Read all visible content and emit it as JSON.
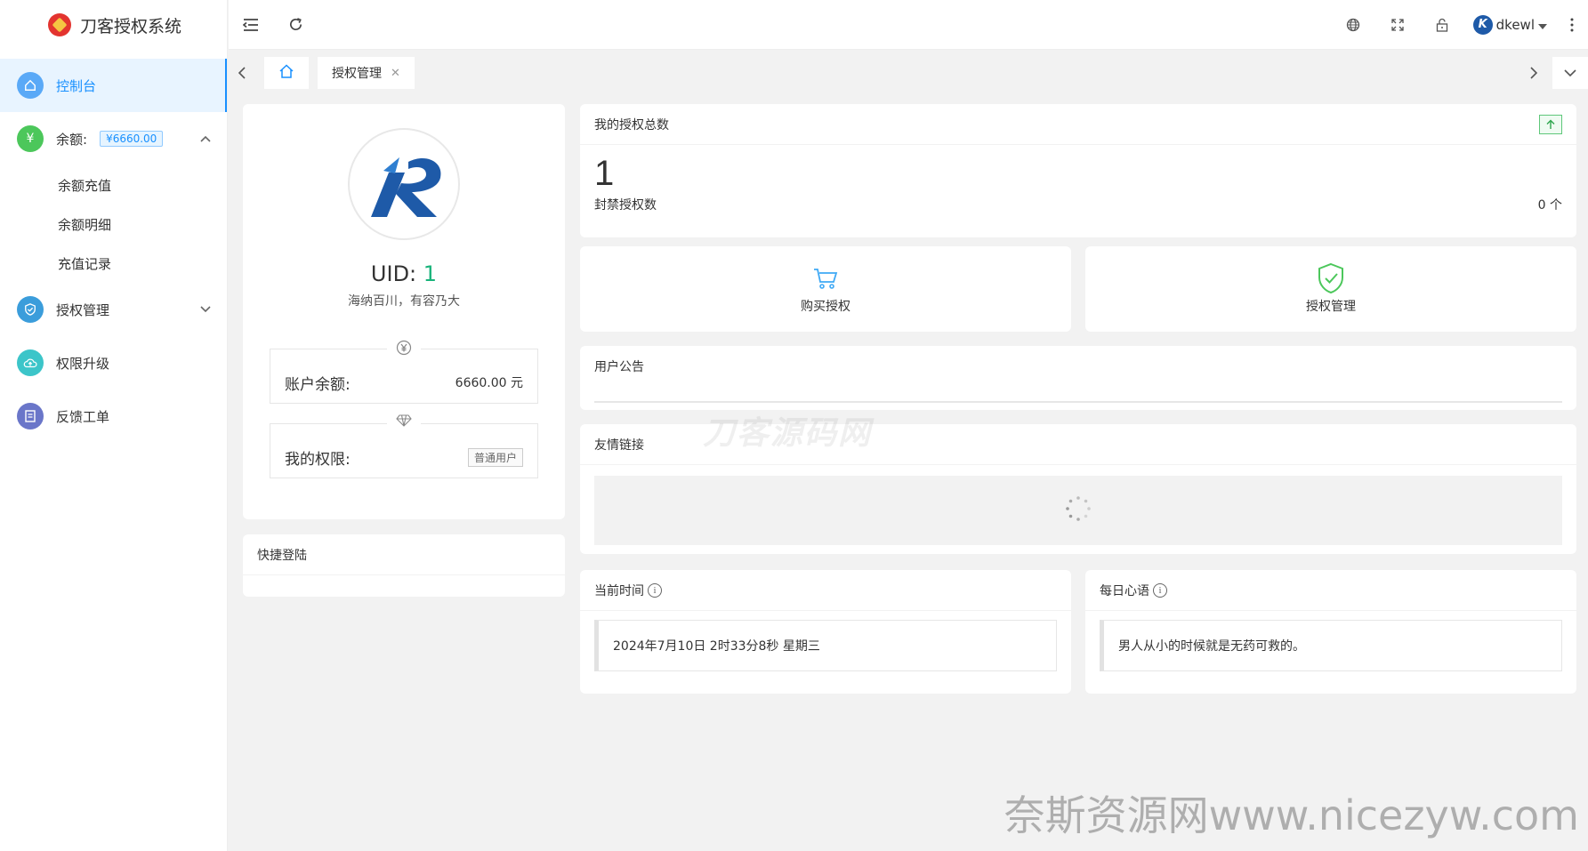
{
  "brand": {
    "title": "刀客授权系统"
  },
  "sidebar": {
    "items": [
      {
        "label": "控制台",
        "icon": "home-icon",
        "color": "#5aa9f7"
      },
      {
        "label": "余额:",
        "badge": "¥6660.00",
        "icon": "yen-icon",
        "color": "#4cc75b"
      },
      {
        "label": "授权管理",
        "icon": "shield-icon",
        "color": "#3b9ddb"
      },
      {
        "label": "权限升级",
        "icon": "cloud-upload-icon",
        "color": "#3cc5c9"
      },
      {
        "label": "反馈工单",
        "icon": "ticket-icon",
        "color": "#6a76c9"
      }
    ],
    "balance_sub": [
      "余额充值",
      "余额明细",
      "充值记录"
    ]
  },
  "header": {
    "username": "dkewl"
  },
  "tabs": {
    "current": "授权管理"
  },
  "profile": {
    "uid_label": "UID:",
    "uid": "1",
    "motto": "海纳百川，有容乃大",
    "balance_label": "账户余额:",
    "balance_value": "6660.00 元",
    "perm_label": "我的权限:",
    "perm_value": "普通用户"
  },
  "quick_login": {
    "title": "快捷登陆"
  },
  "stats": {
    "title": "我的授权总数",
    "total": "1",
    "banned_label": "封禁授权数",
    "banned_value": "0 个"
  },
  "actions": {
    "buy": "购买授权",
    "manage": "授权管理"
  },
  "notice": {
    "title": "用户公告"
  },
  "links": {
    "title": "友情链接"
  },
  "time_card": {
    "title": "当前时间",
    "value": "2024年7月10日 2时33分8秒 星期三"
  },
  "sentence_card": {
    "title": "每日心语",
    "value": "男人从小的时候就是无药可救的。"
  },
  "watermarks": {
    "middle": "刀客源码网",
    "bottom": "奈斯资源网www.nicezyw.com"
  },
  "colors": {
    "accent": "#1890ff",
    "green": "#18b37a"
  }
}
